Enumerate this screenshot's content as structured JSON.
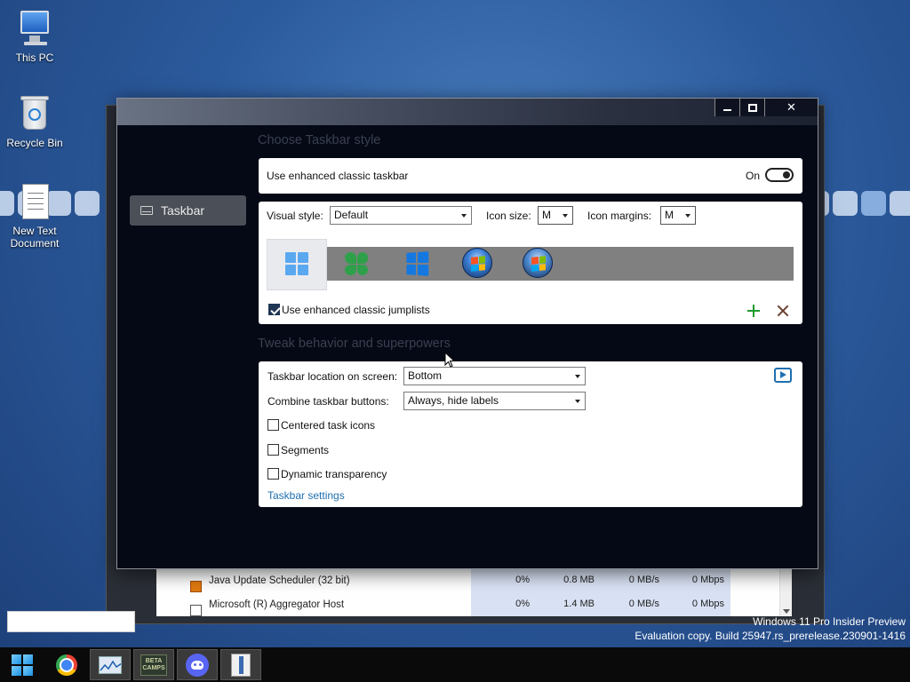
{
  "desktop": {
    "icons": [
      {
        "label": "This PC",
        "icon": "monitor-icon"
      },
      {
        "label": "Recycle Bin",
        "icon": "recycle-bin-icon"
      },
      {
        "label": "New Text Document",
        "icon": "text-document-icon"
      }
    ],
    "watermark": {
      "line1": "Windows 11 Pro Insider Preview",
      "line2": "Evaluation copy. Build 25947.rs_prerelease.230901-1416"
    }
  },
  "background_window": {
    "rows": [
      {
        "name": "Java Update Scheduler (32 bit)",
        "cpu": "0%",
        "memory": "0.8 MB",
        "disk": "0 MB/s",
        "network": "0 Mbps",
        "icon": "java-icon"
      },
      {
        "name": "Microsoft (R) Aggregator Host",
        "cpu": "0%",
        "memory": "1.4 MB",
        "disk": "0 MB/s",
        "network": "0 Mbps",
        "icon": "app-window-icon"
      }
    ]
  },
  "window": {
    "controls": {
      "minimize": "minimize",
      "maximize": "maximize",
      "close": "✕"
    },
    "sidebar": {
      "items": [
        {
          "label": "Taskbar",
          "icon": "taskbar-icon",
          "selected": true
        }
      ]
    },
    "section1": {
      "title": "Choose Taskbar style",
      "enhanced": {
        "label": "Use enhanced classic taskbar",
        "state_label": "On",
        "on": true
      },
      "visual_style": {
        "label": "Visual style:",
        "value": "Default"
      },
      "icon_size": {
        "label": "Icon size:",
        "value": "M"
      },
      "icon_margins": {
        "label": "Icon margins:",
        "value": "M"
      },
      "styles": [
        {
          "name": "windows-11-logo-icon",
          "selected": true
        },
        {
          "name": "clover-logo-icon"
        },
        {
          "name": "windows-10-logo-icon"
        },
        {
          "name": "windows-7-orb-icon"
        },
        {
          "name": "windows-vista-orb-icon"
        }
      ],
      "jumplists": {
        "label": "Use enhanced classic jumplists",
        "checked": true
      }
    },
    "section2": {
      "title": "Tweak behavior and superpowers",
      "location": {
        "label": "Taskbar location on screen:",
        "value": "Bottom"
      },
      "combine": {
        "label": "Combine taskbar buttons:",
        "value": "Always, hide labels"
      },
      "centered": {
        "label": "Centered task icons",
        "checked": false
      },
      "segments": {
        "label": "Segments",
        "checked": false
      },
      "transparency": {
        "label": "Dynamic transparency",
        "checked": false
      },
      "settings_link": "Taskbar settings"
    }
  },
  "taskbar": {
    "apps": [
      {
        "name": "start-icon"
      },
      {
        "name": "chrome-icon"
      },
      {
        "name": "performance-monitor-icon"
      },
      {
        "name": "game-icon",
        "label": "BETA CAMPS"
      },
      {
        "name": "discord-icon"
      },
      {
        "name": "explorer-icon",
        "active": true
      }
    ]
  },
  "colors": {
    "accent": "#1f6fb0",
    "add": "#1e9a2c",
    "remove": "#6a4030",
    "sidebar_selected": "#4b4f58"
  }
}
